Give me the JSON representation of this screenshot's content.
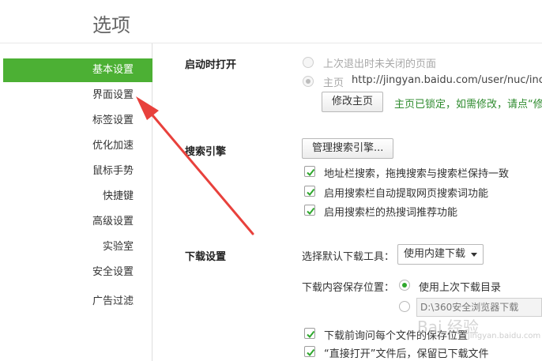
{
  "header": {
    "title": "选项"
  },
  "sidebar": {
    "items": [
      {
        "label": "基本设置",
        "active": true
      },
      {
        "label": "界面设置"
      },
      {
        "label": "标签设置"
      },
      {
        "label": "优化加速"
      },
      {
        "label": "鼠标手势"
      },
      {
        "label": "快捷键"
      },
      {
        "label": "高级设置"
      },
      {
        "label": "实验室"
      },
      {
        "label": "安全设置"
      },
      {
        "label": "广告过滤"
      }
    ]
  },
  "startup": {
    "title": "启动时打开",
    "option_last": "上次退出时未关闭的页面",
    "option_home": "主页",
    "home_url": "http://jingyan.baidu.com/user/nuc/inco",
    "edit_button": "修改主页",
    "locked_notice": "主页已锁定，如需修改，请点“修"
  },
  "search": {
    "title": "搜索引擎",
    "manage_button": "管理搜索引擎...",
    "options": [
      "地址栏搜索，拖拽搜索与搜索栏保持一致",
      "启用搜索栏自动提取网页搜索词功能",
      "启用搜索栏的热搜词推荐功能"
    ]
  },
  "download": {
    "title": "下载设置",
    "tool_label": "选择默认下载工具：",
    "tool_value": "使用内建下载",
    "location_label": "下载内容保存位置：",
    "option_last_dir": "使用上次下载目录",
    "custom_path": "D:\\360安全浏览器下载",
    "ask_location": "下载前询问每个文件的保存位置",
    "keep_after_open": "“直接打开”文件后，保留已下载文件"
  },
  "watermark": {
    "brand": "Bai 经验",
    "sub": "jingyan.baidu.com"
  },
  "colors": {
    "accent": "#4cb034",
    "check": "#2fa82d",
    "arrow": "#e8413c"
  }
}
